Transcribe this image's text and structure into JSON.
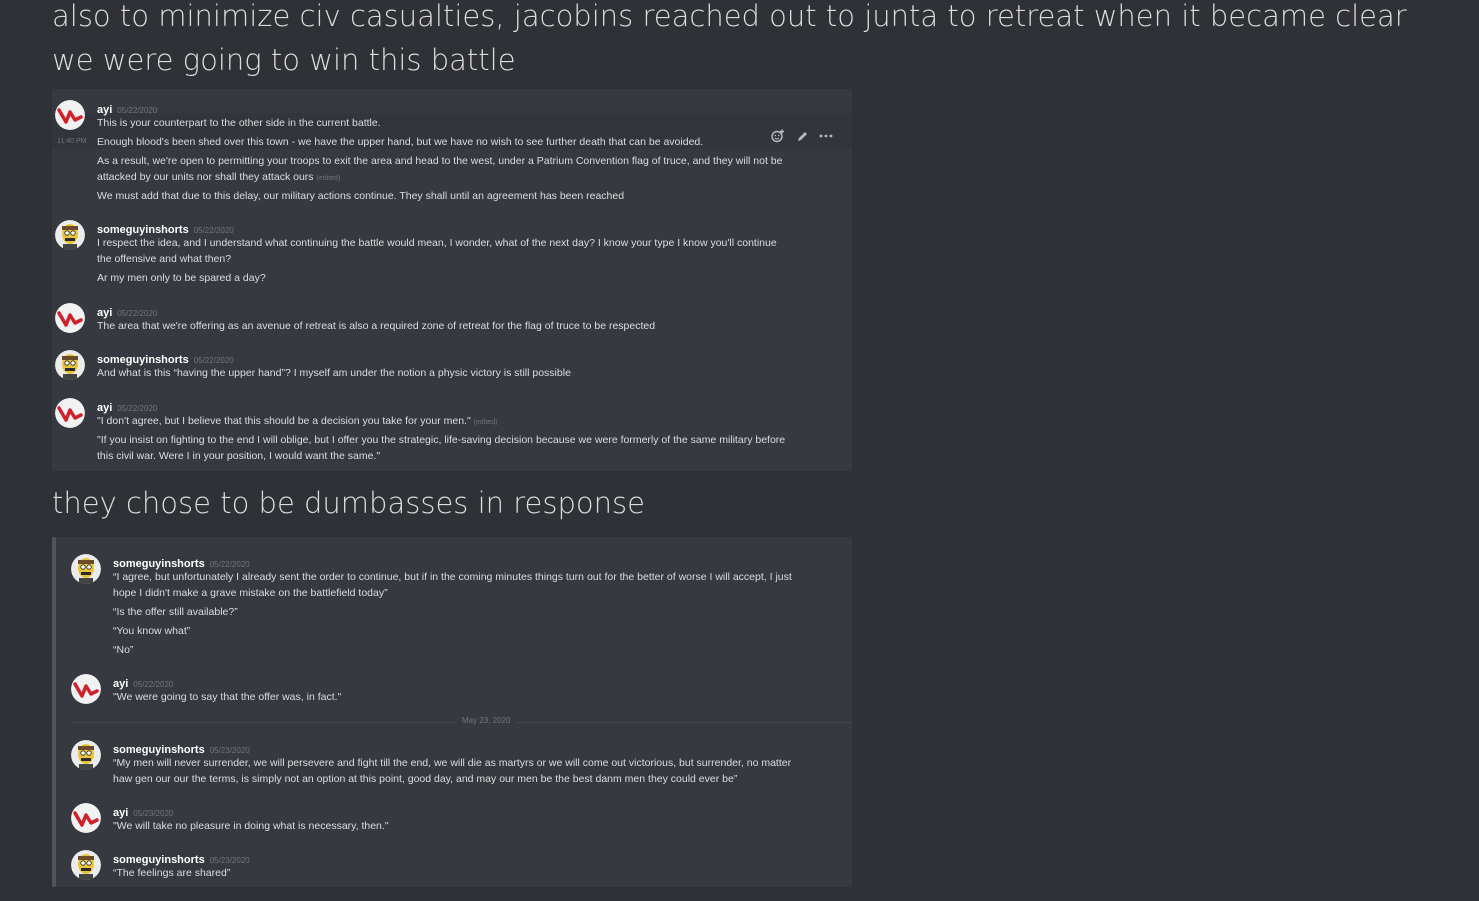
{
  "post": {
    "heading_1": "also to minimize civ casualties, jacobins reached out to junta to retreat when it became clear we were going to win this battle",
    "heading_2": "they chose to be dumbasses in response"
  },
  "shot1": {
    "side_timestamp": "11:40 PM",
    "toolbar": {
      "react_icon": "add-reaction-icon",
      "edit_icon": "pencil-icon",
      "more_icon": "more-icon"
    },
    "messages": [
      {
        "user": "ayi",
        "time": "05/22/2020",
        "lines": [
          "This is your counterpart to the other side in the current battle.",
          "Enough blood's been shed over this town - we have the upper hand, but we have no wish to see further death that can be avoided.",
          "As a result, we're open to permitting your troops to exit the area and head to the west, under a Patrium Convention flag of truce, and they will not be",
          "attacked by our units nor shall they attack ours",
          "We must add that due to this delay, our military actions continue. They shall until an agreement has been reached"
        ],
        "edited": "(edited)"
      },
      {
        "user": "someguyinshorts",
        "time": "05/22/2020",
        "lines": [
          "I respect the idea, and I understand what continuing the battle would mean, I wonder, what of the next day? I know your type I know you'll continue",
          "the offensive and what then?",
          "Ar my men only to be spared a day?"
        ]
      },
      {
        "user": "ayi",
        "time": "05/22/2020",
        "lines": [
          "The area that we're offering as an avenue of retreat is also a required zone of retreat for the flag of truce to be respected"
        ]
      },
      {
        "user": "someguyinshorts",
        "time": "05/22/2020",
        "lines": [
          "And what is this “having the upper hand”? I myself am under the notion a physic victory is still possible"
        ]
      },
      {
        "user": "ayi",
        "time": "05/22/2020",
        "lines": [
          "\"I don't agree, but I believe that this should be a decision you take for your men.\"",
          "\"If you insist on fighting to the end I will oblige, but I offer you the strategic, life-saving decision because we were formerly of the same military before",
          "this civil war. Were I in your position, I would want the same.\""
        ],
        "edited": "(edited)"
      }
    ]
  },
  "shot2": {
    "date_divider": "May 23, 2020",
    "messages": [
      {
        "user": "someguyinshorts",
        "time": "05/22/2020",
        "lines": [
          "“I agree, but unfortunately I already sent the order to continue, but if in the coming minutes things turn out for the better of worse I will accept, I just",
          "hope I didn't make a grave mistake on the battlefield today”",
          "“Is the offer still available?”",
          "“You know what”",
          "“No”"
        ]
      },
      {
        "user": "ayi",
        "time": "05/22/2020",
        "lines": [
          "\"We were going to say that the offer was, in fact.\""
        ]
      },
      {
        "user": "someguyinshorts",
        "time": "05/23/2020",
        "lines": [
          "“My men will never surrender, we will persevere and fight till the end, we will die as martyrs or we will come out victorious, but surrender, no matter",
          "haw gen our our the terms, is simply not an option at this point, good day, and may our men be the best danm men they could ever be”"
        ]
      },
      {
        "user": "ayi",
        "time": "05/23/2020",
        "lines": [
          "\"We will take no pleasure in doing what is necessary, then.\""
        ]
      },
      {
        "user": "someguyinshorts",
        "time": "05/23/2020",
        "lines": [
          "“The feelings are shared”"
        ]
      }
    ]
  }
}
